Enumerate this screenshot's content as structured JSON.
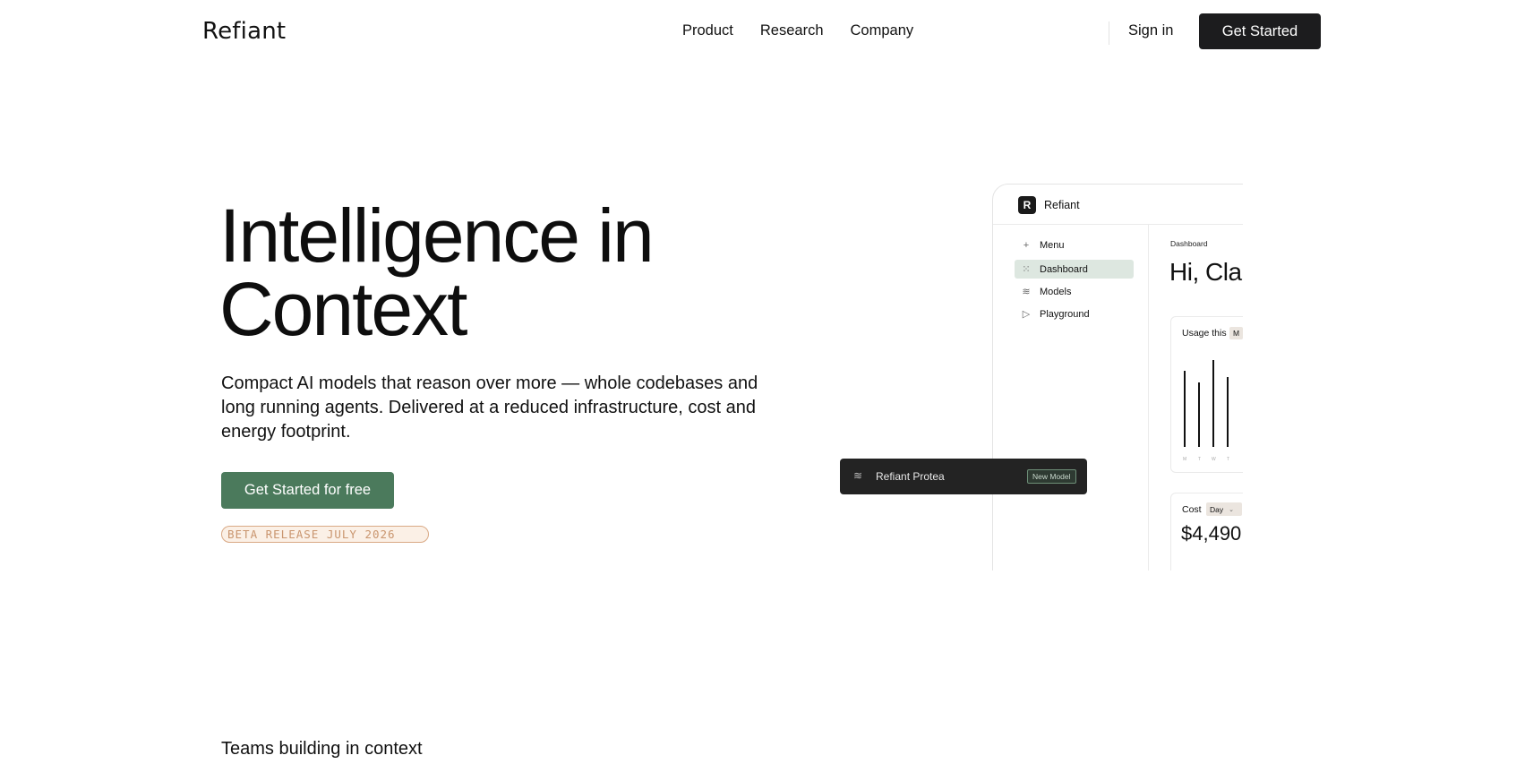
{
  "header": {
    "logo": "Refiant",
    "nav": [
      "Product",
      "Research",
      "Company"
    ],
    "sign_in": "Sign in",
    "get_started": "Get Started"
  },
  "hero": {
    "title_line1": "Intelligence in",
    "title_line2": "Context",
    "subtitle": "Compact AI models that reason over more — whole codebases and long running agents. Delivered at a reduced infrastructure, cost and energy footprint.",
    "cta": "Get Started for free",
    "beta_badge": "BETA RELEASE JULY 2026"
  },
  "mockup": {
    "logo_letter": "R",
    "app_name": "Refiant",
    "sidebar": [
      {
        "label": "Menu",
        "icon": "plus-icon"
      },
      {
        "label": "Dashboard",
        "icon": "grid-icon",
        "active": true
      },
      {
        "label": "Models",
        "icon": "layers-icon"
      },
      {
        "label": "Playground",
        "icon": "play-icon"
      }
    ],
    "page_label": "Dashboard",
    "greeting": "Hi, Clar",
    "usage_card": {
      "title": "Usage this",
      "pill": "M",
      "bar_labels": [
        "M",
        "T",
        "W",
        "T"
      ]
    },
    "cost_card": {
      "title": "Cost",
      "period": "Day",
      "value": "$4,490"
    }
  },
  "banner": {
    "name": "Refiant Protea",
    "badge": "New Model"
  },
  "teams": {
    "heading": "Teams building in context"
  },
  "colors": {
    "accent_green": "#4b7a5c",
    "dark": "#1c1c1e",
    "beta_border": "#d9a985",
    "beta_bg": "#fbf0e6"
  }
}
